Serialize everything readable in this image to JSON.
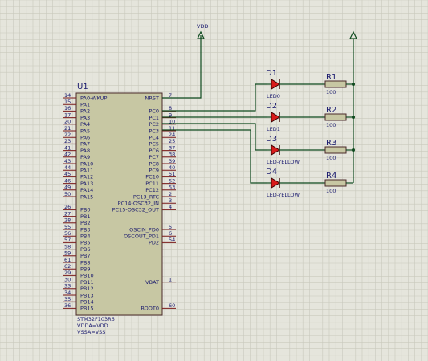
{
  "power": {
    "vdd_label": "VDD"
  },
  "chip": {
    "ref": "U1",
    "part": "STM32F103R6",
    "notes": [
      "VDDA=VDD",
      "VSSA=VSS"
    ],
    "left_pins": [
      {
        "num": "14",
        "name": "PA0-WKUP"
      },
      {
        "num": "15",
        "name": "PA1"
      },
      {
        "num": "16",
        "name": "PA2"
      },
      {
        "num": "17",
        "name": "PA3"
      },
      {
        "num": "20",
        "name": "PA4"
      },
      {
        "num": "21",
        "name": "PA5"
      },
      {
        "num": "22",
        "name": "PA6"
      },
      {
        "num": "23",
        "name": "PA7"
      },
      {
        "num": "41",
        "name": "PA8"
      },
      {
        "num": "42",
        "name": "PA9"
      },
      {
        "num": "43",
        "name": "PA10"
      },
      {
        "num": "44",
        "name": "PA11"
      },
      {
        "num": "45",
        "name": "PA12"
      },
      {
        "num": "46",
        "name": "PA13"
      },
      {
        "num": "49",
        "name": "PA14"
      },
      {
        "num": "50",
        "name": "PA15"
      },
      {
        "num": "",
        "name": ""
      },
      {
        "num": "26",
        "name": "PB0"
      },
      {
        "num": "27",
        "name": "PB1"
      },
      {
        "num": "28",
        "name": "PB2"
      },
      {
        "num": "55",
        "name": "PB3"
      },
      {
        "num": "56",
        "name": "PB4"
      },
      {
        "num": "57",
        "name": "PB5"
      },
      {
        "num": "58",
        "name": "PB6"
      },
      {
        "num": "59",
        "name": "PB7"
      },
      {
        "num": "61",
        "name": "PB8"
      },
      {
        "num": "62",
        "name": "PB9"
      },
      {
        "num": "29",
        "name": "PB10"
      },
      {
        "num": "30",
        "name": "PB11"
      },
      {
        "num": "33",
        "name": "PB12"
      },
      {
        "num": "34",
        "name": "PB13"
      },
      {
        "num": "35",
        "name": "PB14"
      },
      {
        "num": "36",
        "name": "PB15"
      }
    ],
    "right_pins": [
      {
        "num": "7",
        "name": "NRST"
      },
      {
        "num": "",
        "name": ""
      },
      {
        "num": "8",
        "name": "PC0"
      },
      {
        "num": "9",
        "name": "PC1"
      },
      {
        "num": "10",
        "name": "PC2"
      },
      {
        "num": "11",
        "name": "PC3"
      },
      {
        "num": "24",
        "name": "PC4"
      },
      {
        "num": "25",
        "name": "PC5"
      },
      {
        "num": "37",
        "name": "PC6"
      },
      {
        "num": "38",
        "name": "PC7"
      },
      {
        "num": "39",
        "name": "PC8"
      },
      {
        "num": "40",
        "name": "PC9"
      },
      {
        "num": "51",
        "name": "PC10"
      },
      {
        "num": "52",
        "name": "PC11"
      },
      {
        "num": "53",
        "name": "PC12"
      },
      {
        "num": "2",
        "name": "PC13_RTC"
      },
      {
        "num": "3",
        "name": "PC14-OSC32_IN"
      },
      {
        "num": "4",
        "name": "PC15-OSC32_OUT"
      },
      {
        "num": "",
        "name": ""
      },
      {
        "num": "",
        "name": ""
      },
      {
        "num": "5",
        "name": "OSCIN_PD0"
      },
      {
        "num": "6",
        "name": "OSCOUT_PD1"
      },
      {
        "num": "54",
        "name": "PD2"
      },
      {
        "num": "",
        "name": ""
      },
      {
        "num": "",
        "name": ""
      },
      {
        "num": "",
        "name": ""
      },
      {
        "num": "",
        "name": ""
      },
      {
        "num": "",
        "name": ""
      },
      {
        "num": "1",
        "name": "VBAT"
      },
      {
        "num": "",
        "name": ""
      },
      {
        "num": "",
        "name": ""
      },
      {
        "num": "",
        "name": ""
      },
      {
        "num": "60",
        "name": "BOOT0"
      }
    ]
  },
  "leds": [
    {
      "ref": "D1",
      "value": "LED0"
    },
    {
      "ref": "D2",
      "value": "LED1"
    },
    {
      "ref": "D3",
      "value": "LED-YELLOW"
    },
    {
      "ref": "D4",
      "value": "LED-YELLOW"
    }
  ],
  "resistors": [
    {
      "ref": "R1",
      "value": "100"
    },
    {
      "ref": "R2",
      "value": "100"
    },
    {
      "ref": "R3",
      "value": "100"
    },
    {
      "ref": "R4",
      "value": "100"
    }
  ],
  "colors": {
    "background": "#e5e5dc",
    "grid": "#c9c9bd",
    "chip_fill": "#c7c7a3",
    "chip_border": "#4a2a2a",
    "wire": "#0e4a1e",
    "pin": "#7a1a1a",
    "text": "#1a1a6e",
    "led_fill": "#d81b1b",
    "resistor_fill": "#c7c7a3"
  }
}
